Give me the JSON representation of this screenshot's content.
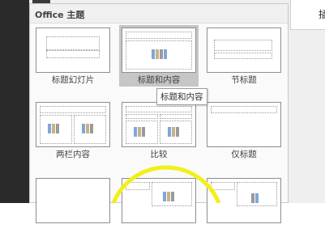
{
  "panel": {
    "title": "Office 主题"
  },
  "layouts": [
    {
      "label": "标题幻灯片",
      "selected": false
    },
    {
      "label": "标题和内容",
      "selected": true
    },
    {
      "label": "节标题",
      "selected": false
    },
    {
      "label": "两栏内容",
      "selected": false
    },
    {
      "label": "比较",
      "selected": false
    },
    {
      "label": "仅标题",
      "selected": false
    },
    {
      "label": "",
      "selected": false
    },
    {
      "label": "",
      "selected": false
    },
    {
      "label": "",
      "selected": false
    }
  ],
  "tooltip": "标题和内容",
  "right_toolbar": {
    "partial_label": "插"
  },
  "colors": {
    "selection": "#c6c6c6",
    "annotation_circle": "#f2ef1a"
  }
}
